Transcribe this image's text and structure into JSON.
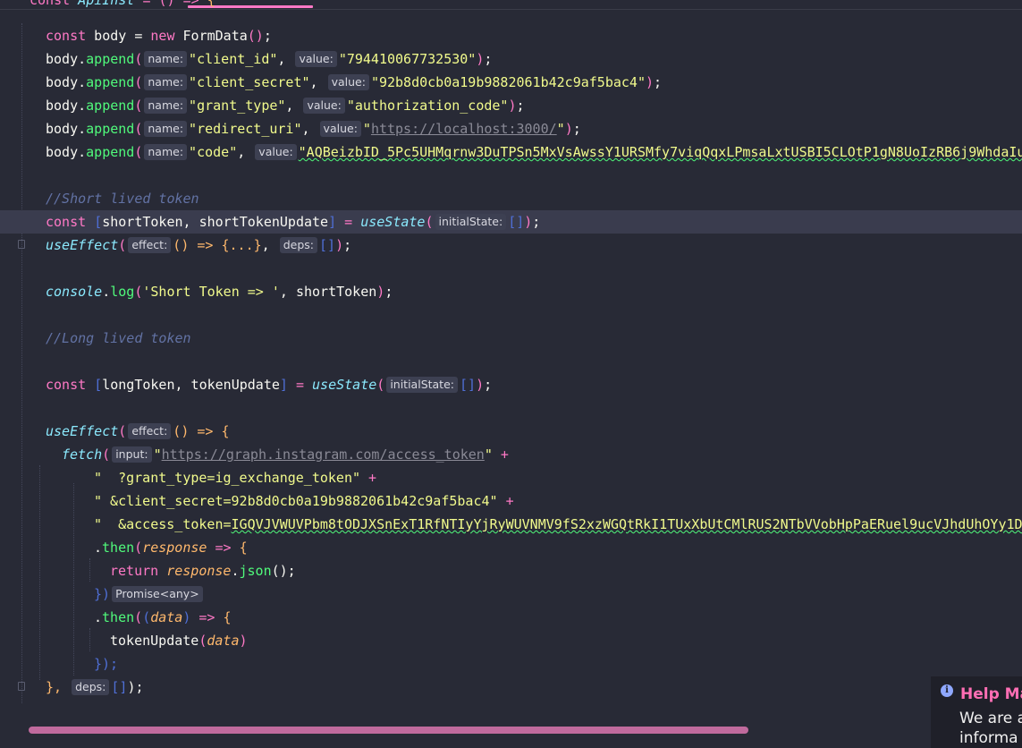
{
  "editor": {
    "lines": {
      "l1": {
        "kw": "const",
        "name": "ApiInst",
        "eq": "=",
        "parens": "()",
        "arrow": "=>",
        "brace": "{"
      },
      "l2": {
        "kw": "const",
        "text": " body = ",
        "new": "new",
        "cls": " FormData",
        "parens": "()",
        "semi": ";"
      },
      "append_lines": [
        {
          "name_hint": "name:",
          "key": "\"client_id\"",
          "value_hint": "value:",
          "value": "\"794410067732530\""
        },
        {
          "name_hint": "name:",
          "key": "\"client_secret\"",
          "value_hint": "value:",
          "value": "\"92b8d0cb0a19b9882061b42c9af5bac4\""
        },
        {
          "name_hint": "name:",
          "key": "\"grant_type\"",
          "value_hint": "value:",
          "value": "\"authorization_code\""
        },
        {
          "name_hint": "name:",
          "key": "\"redirect_uri\"",
          "value_hint": "value:",
          "value_quote": "\"",
          "value_url": "https://localhost:3000/",
          "value_end": "\""
        },
        {
          "name_hint": "name:",
          "key": "\"code\"",
          "value_hint": "value:",
          "value": "\"AQBeizbID_5Pc5UHMqrnw3DuTPSn5MxVsAwssY1URSMfy7viqQqxLPmsaLxtUSBI5CLOtP1gN8UoIzRB6j9WhdaIu"
        }
      ],
      "append_obj": "body",
      "append_method": "append",
      "comment_short": "//Short lived token",
      "short_state": {
        "kw": "const",
        "destruct": "shortToken, shortTokenUpdate",
        "fn": "useState",
        "hint": "initialState:",
        "init": "[]"
      },
      "short_effect": {
        "fn": "useEffect",
        "effect_hint": "effect:",
        "body": "() => {...}",
        "deps_hint": "deps:",
        "deps": "[]"
      },
      "console": {
        "obj": "console",
        "method": "log",
        "str": "'Short Token => '",
        "arg": "shortToken"
      },
      "comment_long": "//Long lived token",
      "long_state": {
        "kw": "const",
        "destruct": "longToken, tokenUpdate",
        "fn": "useState",
        "hint": "initialState:",
        "init": "[]"
      },
      "long_effect": {
        "fn": "useEffect",
        "effect_hint": "effect:",
        "head": "() => {"
      },
      "fetch": {
        "fn": "fetch",
        "hint": "input:",
        "url": "https://graph.instagram.com/access_token",
        "plus": "+"
      },
      "q1": "\"  ?grant_type=ig_exchange_token\"",
      "q2": "\" &client_secret=92b8d0cb0a19b9882061b42c9af5bac4\"",
      "q3_prefix": "\"  &access_token=",
      "q3_token": "IGQVJVWUVPbm8tODJXSnExT1RfNTIyYjRyWUVNMV9fS2xzWGQtRkI1TUxXbUtCMlRUS2NTbVVobHpPaERuel9ucVJhdUhOYy1DR",
      "then1": {
        "method": "then",
        "param": "response",
        "arrow": "=>",
        "brace": "{"
      },
      "ret": {
        "kw": "return",
        "param": "response",
        "method": "json",
        "tail": "();"
      },
      "close1": {
        "text": "})",
        "hint": "Promise<any>"
      },
      "then2": {
        "method": "then",
        "param": "data",
        "arrow": "=>",
        "brace": "{"
      },
      "update": {
        "fn": "tokenUpdate",
        "param": "data"
      },
      "close2": "});",
      "close3": {
        "text": "},",
        "hint": "deps:",
        "deps": "[]",
        "tail": ");"
      }
    }
  },
  "help": {
    "icon": "i",
    "title": "Help Ma",
    "body1": "We are a",
    "body2": "informa"
  },
  "colors": {
    "background": "#282a36",
    "keyword": "#ff79c6",
    "string": "#f1fa8c",
    "function": "#8be9fd",
    "method": "#50fa7b",
    "comment": "#6272a4",
    "help_title": "#ff6eb4"
  }
}
